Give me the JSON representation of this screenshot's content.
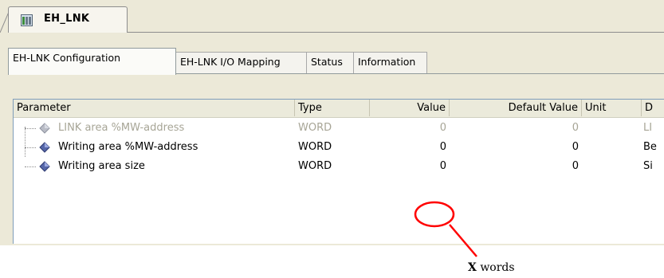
{
  "document_tab": {
    "label": "EH_LNK",
    "icon": "device-module-icon"
  },
  "tabs": [
    {
      "label": "EH-LNK Configuration",
      "active": true
    },
    {
      "label": "EH-LNK I/O Mapping",
      "active": false
    },
    {
      "label": "Status",
      "active": false
    },
    {
      "label": "Information",
      "active": false
    }
  ],
  "grid": {
    "columns": [
      "Parameter",
      "Type",
      "Value",
      "Default Value",
      "Unit",
      "D"
    ],
    "rows": [
      {
        "parameter": "LINK area %MW-address",
        "type": "WORD",
        "value": "0",
        "default_value": "0",
        "unit": "",
        "description": "LI",
        "disabled": true
      },
      {
        "parameter": "Writing area %MW-address",
        "type": "WORD",
        "value": "0",
        "default_value": "0",
        "unit": "",
        "description": "Be",
        "disabled": false
      },
      {
        "parameter": "Writing area size",
        "type": "WORD",
        "value": "0",
        "default_value": "0",
        "unit": "",
        "description": "Si",
        "disabled": false
      }
    ]
  },
  "annotation": {
    "bold": "X",
    "text": " words",
    "color": "#ff0000"
  }
}
